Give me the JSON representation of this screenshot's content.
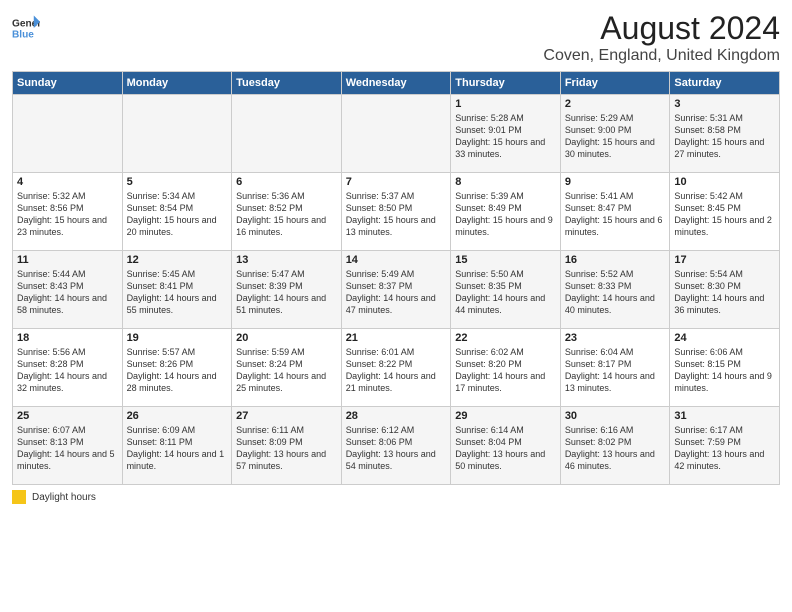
{
  "header": {
    "logo_general": "General",
    "logo_blue": "Blue",
    "title": "August 2024",
    "subtitle": "Coven, England, United Kingdom"
  },
  "days_of_week": [
    "Sunday",
    "Monday",
    "Tuesday",
    "Wednesday",
    "Thursday",
    "Friday",
    "Saturday"
  ],
  "legend": {
    "label": "Daylight hours"
  },
  "weeks": [
    [
      {
        "day": "",
        "sunrise": "",
        "sunset": "",
        "daylight": ""
      },
      {
        "day": "",
        "sunrise": "",
        "sunset": "",
        "daylight": ""
      },
      {
        "day": "",
        "sunrise": "",
        "sunset": "",
        "daylight": ""
      },
      {
        "day": "",
        "sunrise": "",
        "sunset": "",
        "daylight": ""
      },
      {
        "day": "1",
        "sunrise": "Sunrise: 5:28 AM",
        "sunset": "Sunset: 9:01 PM",
        "daylight": "Daylight: 15 hours and 33 minutes."
      },
      {
        "day": "2",
        "sunrise": "Sunrise: 5:29 AM",
        "sunset": "Sunset: 9:00 PM",
        "daylight": "Daylight: 15 hours and 30 minutes."
      },
      {
        "day": "3",
        "sunrise": "Sunrise: 5:31 AM",
        "sunset": "Sunset: 8:58 PM",
        "daylight": "Daylight: 15 hours and 27 minutes."
      }
    ],
    [
      {
        "day": "4",
        "sunrise": "Sunrise: 5:32 AM",
        "sunset": "Sunset: 8:56 PM",
        "daylight": "Daylight: 15 hours and 23 minutes."
      },
      {
        "day": "5",
        "sunrise": "Sunrise: 5:34 AM",
        "sunset": "Sunset: 8:54 PM",
        "daylight": "Daylight: 15 hours and 20 minutes."
      },
      {
        "day": "6",
        "sunrise": "Sunrise: 5:36 AM",
        "sunset": "Sunset: 8:52 PM",
        "daylight": "Daylight: 15 hours and 16 minutes."
      },
      {
        "day": "7",
        "sunrise": "Sunrise: 5:37 AM",
        "sunset": "Sunset: 8:50 PM",
        "daylight": "Daylight: 15 hours and 13 minutes."
      },
      {
        "day": "8",
        "sunrise": "Sunrise: 5:39 AM",
        "sunset": "Sunset: 8:49 PM",
        "daylight": "Daylight: 15 hours and 9 minutes."
      },
      {
        "day": "9",
        "sunrise": "Sunrise: 5:41 AM",
        "sunset": "Sunset: 8:47 PM",
        "daylight": "Daylight: 15 hours and 6 minutes."
      },
      {
        "day": "10",
        "sunrise": "Sunrise: 5:42 AM",
        "sunset": "Sunset: 8:45 PM",
        "daylight": "Daylight: 15 hours and 2 minutes."
      }
    ],
    [
      {
        "day": "11",
        "sunrise": "Sunrise: 5:44 AM",
        "sunset": "Sunset: 8:43 PM",
        "daylight": "Daylight: 14 hours and 58 minutes."
      },
      {
        "day": "12",
        "sunrise": "Sunrise: 5:45 AM",
        "sunset": "Sunset: 8:41 PM",
        "daylight": "Daylight: 14 hours and 55 minutes."
      },
      {
        "day": "13",
        "sunrise": "Sunrise: 5:47 AM",
        "sunset": "Sunset: 8:39 PM",
        "daylight": "Daylight: 14 hours and 51 minutes."
      },
      {
        "day": "14",
        "sunrise": "Sunrise: 5:49 AM",
        "sunset": "Sunset: 8:37 PM",
        "daylight": "Daylight: 14 hours and 47 minutes."
      },
      {
        "day": "15",
        "sunrise": "Sunrise: 5:50 AM",
        "sunset": "Sunset: 8:35 PM",
        "daylight": "Daylight: 14 hours and 44 minutes."
      },
      {
        "day": "16",
        "sunrise": "Sunrise: 5:52 AM",
        "sunset": "Sunset: 8:33 PM",
        "daylight": "Daylight: 14 hours and 40 minutes."
      },
      {
        "day": "17",
        "sunrise": "Sunrise: 5:54 AM",
        "sunset": "Sunset: 8:30 PM",
        "daylight": "Daylight: 14 hours and 36 minutes."
      }
    ],
    [
      {
        "day": "18",
        "sunrise": "Sunrise: 5:56 AM",
        "sunset": "Sunset: 8:28 PM",
        "daylight": "Daylight: 14 hours and 32 minutes."
      },
      {
        "day": "19",
        "sunrise": "Sunrise: 5:57 AM",
        "sunset": "Sunset: 8:26 PM",
        "daylight": "Daylight: 14 hours and 28 minutes."
      },
      {
        "day": "20",
        "sunrise": "Sunrise: 5:59 AM",
        "sunset": "Sunset: 8:24 PM",
        "daylight": "Daylight: 14 hours and 25 minutes."
      },
      {
        "day": "21",
        "sunrise": "Sunrise: 6:01 AM",
        "sunset": "Sunset: 8:22 PM",
        "daylight": "Daylight: 14 hours and 21 minutes."
      },
      {
        "day": "22",
        "sunrise": "Sunrise: 6:02 AM",
        "sunset": "Sunset: 8:20 PM",
        "daylight": "Daylight: 14 hours and 17 minutes."
      },
      {
        "day": "23",
        "sunrise": "Sunrise: 6:04 AM",
        "sunset": "Sunset: 8:17 PM",
        "daylight": "Daylight: 14 hours and 13 minutes."
      },
      {
        "day": "24",
        "sunrise": "Sunrise: 6:06 AM",
        "sunset": "Sunset: 8:15 PM",
        "daylight": "Daylight: 14 hours and 9 minutes."
      }
    ],
    [
      {
        "day": "25",
        "sunrise": "Sunrise: 6:07 AM",
        "sunset": "Sunset: 8:13 PM",
        "daylight": "Daylight: 14 hours and 5 minutes."
      },
      {
        "day": "26",
        "sunrise": "Sunrise: 6:09 AM",
        "sunset": "Sunset: 8:11 PM",
        "daylight": "Daylight: 14 hours and 1 minute."
      },
      {
        "day": "27",
        "sunrise": "Sunrise: 6:11 AM",
        "sunset": "Sunset: 8:09 PM",
        "daylight": "Daylight: 13 hours and 57 minutes."
      },
      {
        "day": "28",
        "sunrise": "Sunrise: 6:12 AM",
        "sunset": "Sunset: 8:06 PM",
        "daylight": "Daylight: 13 hours and 54 minutes."
      },
      {
        "day": "29",
        "sunrise": "Sunrise: 6:14 AM",
        "sunset": "Sunset: 8:04 PM",
        "daylight": "Daylight: 13 hours and 50 minutes."
      },
      {
        "day": "30",
        "sunrise": "Sunrise: 6:16 AM",
        "sunset": "Sunset: 8:02 PM",
        "daylight": "Daylight: 13 hours and 46 minutes."
      },
      {
        "day": "31",
        "sunrise": "Sunrise: 6:17 AM",
        "sunset": "Sunset: 7:59 PM",
        "daylight": "Daylight: 13 hours and 42 minutes."
      }
    ]
  ]
}
